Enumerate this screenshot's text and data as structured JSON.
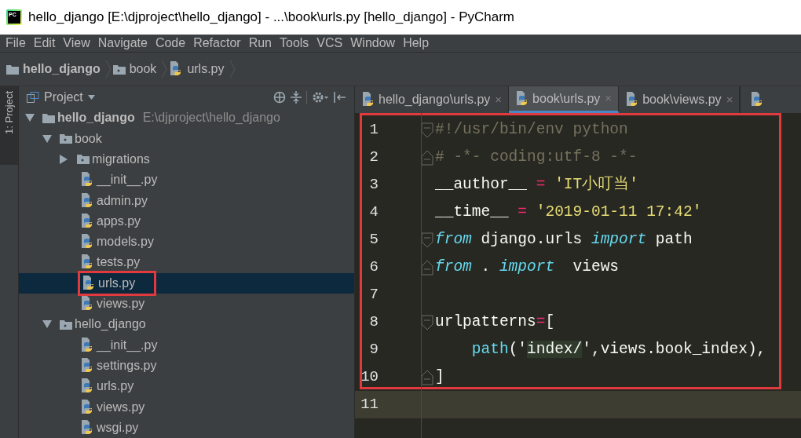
{
  "window": {
    "icon_text": "PC",
    "title": "hello_django [E:\\djproject\\hello_django] - ...\\book\\urls.py [hello_django] - PyCharm"
  },
  "menu": [
    "File",
    "Edit",
    "View",
    "Navigate",
    "Code",
    "Refactor",
    "Run",
    "Tools",
    "VCS",
    "Window",
    "Help"
  ],
  "breadcrumb": [
    {
      "label": "hello_django",
      "kind": "project"
    },
    {
      "label": "book",
      "kind": "folder"
    },
    {
      "label": "urls.py",
      "kind": "file"
    }
  ],
  "tool_strip": {
    "label": "1: Project"
  },
  "project_panel": {
    "title": "Project",
    "tree": [
      {
        "label": "hello_django",
        "path": "E:\\djproject\\hello_django",
        "kind": "project",
        "expanded": true,
        "selected": false,
        "children": [
          {
            "label": "book",
            "kind": "folder",
            "expanded": true,
            "selected": false,
            "children": [
              {
                "label": "migrations",
                "kind": "folder",
                "expanded": false,
                "selected": false
              },
              {
                "label": "__init__.py",
                "kind": "file",
                "selected": false
              },
              {
                "label": "admin.py",
                "kind": "file",
                "selected": false
              },
              {
                "label": "apps.py",
                "kind": "file",
                "selected": false
              },
              {
                "label": "models.py",
                "kind": "file",
                "selected": false
              },
              {
                "label": "tests.py",
                "kind": "file",
                "selected": false
              },
              {
                "label": "urls.py",
                "kind": "file",
                "selected": true
              },
              {
                "label": "views.py",
                "kind": "file",
                "selected": false
              }
            ]
          },
          {
            "label": "hello_django",
            "kind": "folder",
            "expanded": true,
            "selected": false,
            "children": [
              {
                "label": "__init__.py",
                "kind": "file",
                "selected": false
              },
              {
                "label": "settings.py",
                "kind": "file",
                "selected": false
              },
              {
                "label": "urls.py",
                "kind": "file",
                "selected": false
              },
              {
                "label": "views.py",
                "kind": "file",
                "selected": false
              },
              {
                "label": "wsgi.py",
                "kind": "file",
                "selected": false
              }
            ]
          }
        ]
      }
    ]
  },
  "tabs": [
    {
      "label": "hello_django\\urls.py",
      "close": "×",
      "selected": false
    },
    {
      "label": "book\\urls.py",
      "close": "×",
      "selected": true
    },
    {
      "label": "book\\views.py",
      "close": "×",
      "selected": false
    }
  ],
  "editor": {
    "lines": [
      {
        "number": "1",
        "fold_start": true,
        "fold_end": false,
        "current": false,
        "tokens": [
          {
            "text": "#!/usr/bin/env python",
            "kind": "comment"
          }
        ]
      },
      {
        "number": "2",
        "fold_start": false,
        "fold_end": true,
        "current": false,
        "tokens": [
          {
            "text": "# -*- coding:utf-8 -*-",
            "kind": "comment"
          }
        ]
      },
      {
        "number": "3",
        "fold_start": false,
        "fold_end": false,
        "current": false,
        "tokens": [
          {
            "text": "__author__ ",
            "kind": "plain"
          },
          {
            "text": "=",
            "kind": "operator"
          },
          {
            "text": " 'IT小叮当'",
            "kind": "string"
          }
        ]
      },
      {
        "number": "4",
        "fold_start": false,
        "fold_end": false,
        "current": false,
        "tokens": [
          {
            "text": "__time__ ",
            "kind": "plain"
          },
          {
            "text": "=",
            "kind": "operator"
          },
          {
            "text": " '2019-01-11 17:42'",
            "kind": "string"
          }
        ]
      },
      {
        "number": "5",
        "fold_start": true,
        "fold_end": false,
        "current": false,
        "tokens": [
          {
            "text": "from",
            "kind": "keyword"
          },
          {
            "text": " django.urls ",
            "kind": "plain"
          },
          {
            "text": "import",
            "kind": "keyword"
          },
          {
            "text": " path",
            "kind": "plain"
          }
        ]
      },
      {
        "number": "6",
        "fold_start": false,
        "fold_end": true,
        "current": false,
        "tokens": [
          {
            "text": "from",
            "kind": "keyword"
          },
          {
            "text": " . ",
            "kind": "plain"
          },
          {
            "text": "import",
            "kind": "keyword"
          },
          {
            "text": "  views",
            "kind": "plain"
          }
        ]
      },
      {
        "number": "7",
        "fold_start": false,
        "fold_end": false,
        "current": false
      },
      {
        "number": "8",
        "fold_start": true,
        "fold_end": false,
        "current": false,
        "tokens": [
          {
            "text": "urlpatterns",
            "kind": "plain"
          },
          {
            "text": "=",
            "kind": "operator"
          },
          {
            "text": "[",
            "kind": "plain"
          }
        ]
      },
      {
        "number": "9",
        "fold_start": false,
        "fold_end": false,
        "current": false,
        "tokens": [
          {
            "text": "    path",
            "kind": "builtin"
          },
          {
            "text": "('",
            "kind": "plain"
          },
          {
            "text": "index/",
            "kind": "injected"
          },
          {
            "text": "',views.book_index),",
            "kind": "plain"
          }
        ]
      },
      {
        "number": "10",
        "fold_start": false,
        "fold_end": true,
        "current": false,
        "tokens": [
          {
            "text": "]",
            "kind": "plain"
          }
        ]
      },
      {
        "number": "11",
        "fold_start": false,
        "fold_end": false,
        "current": true
      }
    ]
  }
}
